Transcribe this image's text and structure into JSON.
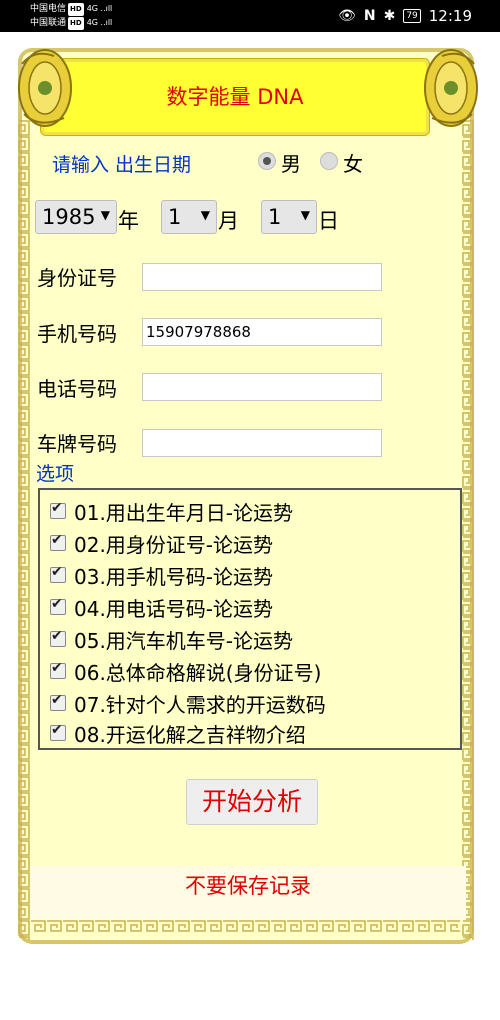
{
  "status_bar": {
    "carrier1": "中国电信",
    "carrier2": "中国联通",
    "hd": "HD",
    "signal1": "4G ..ıll",
    "signal2": "4G ..ıll",
    "battery": "79",
    "time": "12:19",
    "icons": [
      "eye-icon",
      "nfc-icon",
      "bluetooth-icon",
      "battery-icon"
    ]
  },
  "banner": {
    "title": "数字能量 DNA"
  },
  "form": {
    "prompt": "请输入  出生日期",
    "gender": {
      "options": [
        {
          "label": "男",
          "selected": true
        },
        {
          "label": "女",
          "selected": false
        }
      ]
    },
    "birth": {
      "year": {
        "value": "1985",
        "unit": "年"
      },
      "month": {
        "value": "1",
        "unit": "月"
      },
      "day": {
        "value": "1",
        "unit": "日"
      }
    },
    "fields": [
      {
        "label": "身份证号",
        "value": ""
      },
      {
        "label": "手机号码",
        "value": "15907978868"
      },
      {
        "label": "电话号码",
        "value": ""
      },
      {
        "label": "车牌号码",
        "value": ""
      }
    ]
  },
  "options_section": {
    "title": "选项",
    "items": [
      {
        "label": "01.用出生年月日-论运势",
        "checked": true
      },
      {
        "label": "02.用身份证号-论运势",
        "checked": true
      },
      {
        "label": "03.用手机号码-论运势",
        "checked": true
      },
      {
        "label": "04.用电话号码-论运势",
        "checked": true
      },
      {
        "label": "05.用汽车机车号-论运势",
        "checked": true
      },
      {
        "label": "06.总体命格解说(身份证号)",
        "checked": true
      },
      {
        "label": "07.针对个人需求的开运数码",
        "checked": true
      },
      {
        "label": "08.开运化解之吉祥物介绍",
        "checked": true
      }
    ]
  },
  "actions": {
    "analyze_label": "开始分析",
    "no_save_label": "不要保存记录"
  },
  "colors": {
    "banner_bg": "#ffff33",
    "card_bg": "#ffffc8",
    "accent_red": "#e00000",
    "label_blue": "#0033cc",
    "border_gold": "#d8c66a"
  }
}
